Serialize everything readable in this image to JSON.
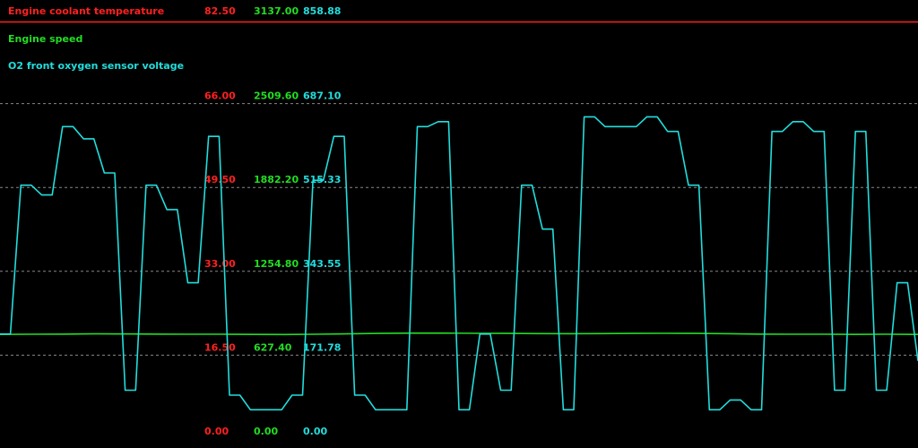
{
  "chart_data": {
    "type": "line",
    "legend": "top-left",
    "grid": true,
    "series": [
      {
        "name": "Engine coolant temperature",
        "color": "#ff2020",
        "ylim": [
          0,
          82.5
        ],
        "ticks": [
          "0.00",
          "16.50",
          "33.00",
          "49.50",
          "66.00",
          "82.50"
        ],
        "values": [
          82.5,
          82.5,
          82.5,
          82.5,
          82.5,
          82.5
        ]
      },
      {
        "name": "Engine speed",
        "color": "#22dd22",
        "ylim": [
          0,
          3137
        ],
        "ticks": [
          "0.00",
          "627.40",
          "1254.80",
          "1882.20",
          "2509.60",
          "3137.00"
        ],
        "values": [
          783,
          784,
          785,
          787,
          786,
          785,
          784,
          784,
          783,
          782,
          784,
          787,
          790,
          792,
          792,
          791,
          790,
          789,
          788,
          789,
          790,
          791,
          790,
          788,
          785,
          784,
          784,
          783,
          784,
          783
        ]
      },
      {
        "name": "O2 front oxygen sensor voltage",
        "color": "#22dddd",
        "ylim": [
          0,
          858.88
        ],
        "ticks": [
          "0.00",
          "171.78",
          "343.55",
          "515.33",
          "687.10",
          "858.88"
        ],
        "values": [
          215,
          215,
          520,
          520,
          500,
          500,
          640,
          640,
          615,
          615,
          545,
          545,
          100,
          100,
          520,
          520,
          470,
          470,
          320,
          320,
          620,
          620,
          90,
          90,
          60,
          60,
          60,
          60,
          90,
          90,
          530,
          530,
          620,
          620,
          90,
          90,
          60,
          60,
          60,
          60,
          640,
          640,
          650,
          650,
          60,
          60,
          215,
          215,
          100,
          100,
          520,
          520,
          430,
          430,
          60,
          60,
          660,
          660,
          640,
          640,
          640,
          640,
          660,
          660,
          630,
          630,
          520,
          520,
          60,
          60,
          80,
          80,
          60,
          60,
          630,
          630,
          650,
          650,
          630,
          630,
          100,
          100,
          630,
          630,
          100,
          100,
          320,
          320,
          160
        ]
      }
    ]
  }
}
